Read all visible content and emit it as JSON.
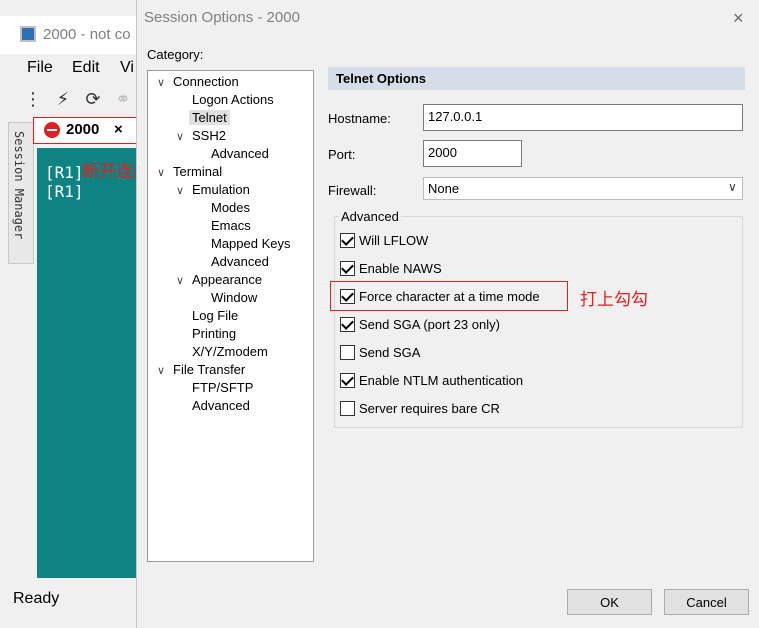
{
  "background_window": {
    "title": "2000 - not co",
    "menu": [
      "File",
      "Edit",
      "Vi"
    ],
    "session_manager_label": "Session Manager",
    "tab_label": "2000",
    "tab_close": "×",
    "terminal_lines": [
      "[R1]",
      "[R1]"
    ],
    "status": "Ready"
  },
  "annotations": {
    "disconnect": "断开连接",
    "check_it": "打上勾勾"
  },
  "dialog": {
    "title": "Session Options - 2000",
    "close": "×",
    "category_label": "Category:",
    "tree": [
      {
        "label": "Connection",
        "level": 0,
        "expanded": true
      },
      {
        "label": "Logon Actions",
        "level": 1
      },
      {
        "label": "Telnet",
        "level": 1,
        "selected": true
      },
      {
        "label": "SSH2",
        "level": 1,
        "expanded": true
      },
      {
        "label": "Advanced",
        "level": 2
      },
      {
        "label": "Terminal",
        "level": 0,
        "expanded": true
      },
      {
        "label": "Emulation",
        "level": 1,
        "expanded": true
      },
      {
        "label": "Modes",
        "level": 2
      },
      {
        "label": "Emacs",
        "level": 2
      },
      {
        "label": "Mapped Keys",
        "level": 2
      },
      {
        "label": "Advanced",
        "level": 2
      },
      {
        "label": "Appearance",
        "level": 1,
        "expanded": true
      },
      {
        "label": "Window",
        "level": 2
      },
      {
        "label": "Log File",
        "level": 1
      },
      {
        "label": "Printing",
        "level": 1
      },
      {
        "label": "X/Y/Zmodem",
        "level": 1
      },
      {
        "label": "File Transfer",
        "level": 0,
        "expanded": true
      },
      {
        "label": "FTP/SFTP",
        "level": 1
      },
      {
        "label": "Advanced",
        "level": 1
      }
    ],
    "panel_title": "Telnet Options",
    "hostname_label": "Hostname:",
    "hostname_value": "127.0.0.1",
    "port_label": "Port:",
    "port_value": "2000",
    "firewall_label": "Firewall:",
    "firewall_value": "None",
    "advanced_label": "Advanced",
    "options": [
      {
        "label": "Will LFLOW",
        "checked": true
      },
      {
        "label": "Enable NAWS",
        "checked": true
      },
      {
        "label": "Force character at a time mode",
        "checked": true
      },
      {
        "label": "Send SGA (port 23 only)",
        "checked": true
      },
      {
        "label": "Send SGA",
        "checked": false
      },
      {
        "label": "Enable NTLM authentication",
        "checked": true
      },
      {
        "label": "Server requires bare CR",
        "checked": false
      }
    ],
    "ok_label": "OK",
    "cancel_label": "Cancel"
  }
}
